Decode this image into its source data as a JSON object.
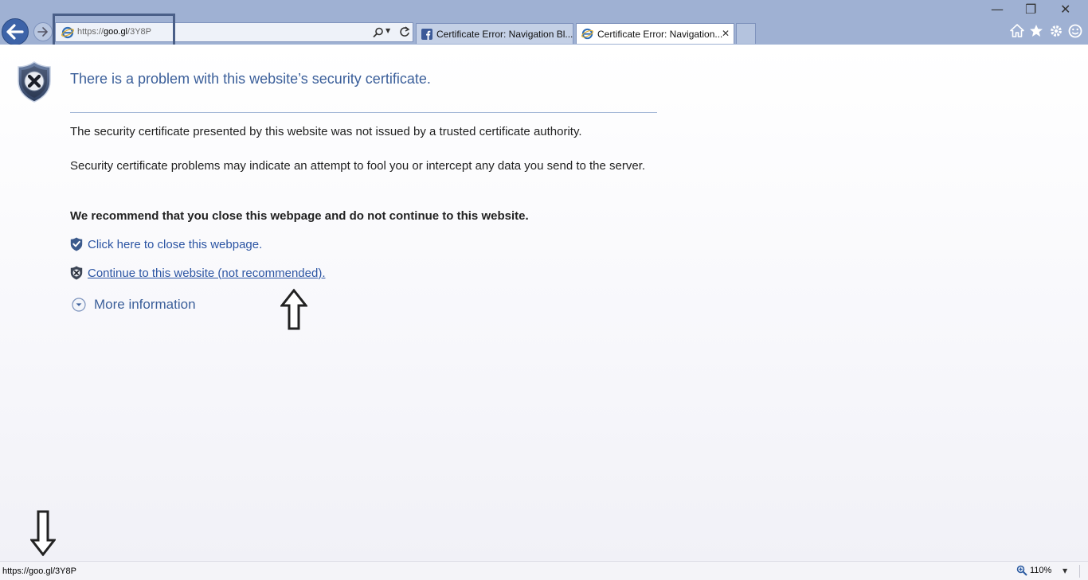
{
  "browser": {
    "address_bar": {
      "url_protocol": "https://",
      "url_host": "goo.gl",
      "url_path": "/3Y8P"
    },
    "tabs": [
      {
        "title": "Certificate Error: Navigation Bl...",
        "icon": "facebook-icon",
        "active": false
      },
      {
        "title": "Certificate Error: Navigation...",
        "icon": "ie-icon",
        "active": true,
        "close_label": "✕"
      }
    ],
    "window_controls": {
      "minimize": "—",
      "restore": "❐",
      "close": "✕"
    },
    "command_icons": [
      "home-icon",
      "favorites-star-icon",
      "tools-gear-icon",
      "feedback-smiley-icon"
    ]
  },
  "page": {
    "title": "There is a problem with this website’s security certificate.",
    "paragraph_1": "The security certificate presented by this website was not issued by a trusted certificate authority.",
    "paragraph_2": "Security certificate problems may indicate an attempt to fool you or intercept any data you send to the server.",
    "recommendation": "We recommend that you close this webpage and do not continue to this website.",
    "close_link": "Click here to close this webpage.",
    "continue_link": "Continue to this website (not recommended).",
    "more_info": "More information"
  },
  "statusbar": {
    "hover_url": "https://goo.gl/3Y8P",
    "zoom": "110%"
  },
  "colors": {
    "toolbar_bg": "#9fb1d3",
    "title_blue": "#3b5f9a",
    "link_blue": "#2c55a3",
    "highlight_box": "#4a5f88"
  }
}
